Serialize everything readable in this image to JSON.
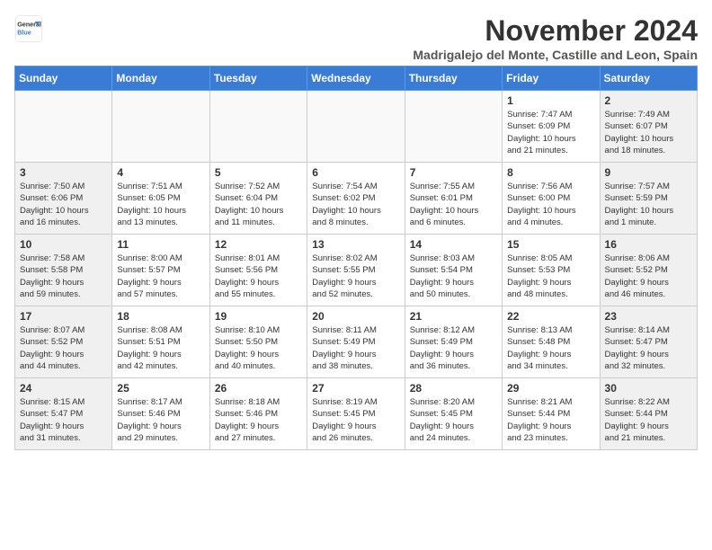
{
  "logo": {
    "line1": "General",
    "line2": "Blue"
  },
  "title": "November 2024",
  "subtitle": "Madrigalejo del Monte, Castille and Leon, Spain",
  "days_of_week": [
    "Sunday",
    "Monday",
    "Tuesday",
    "Wednesday",
    "Thursday",
    "Friday",
    "Saturday"
  ],
  "weeks": [
    [
      {
        "day": "",
        "info": ""
      },
      {
        "day": "",
        "info": ""
      },
      {
        "day": "",
        "info": ""
      },
      {
        "day": "",
        "info": ""
      },
      {
        "day": "",
        "info": ""
      },
      {
        "day": "1",
        "info": "Sunrise: 7:47 AM\nSunset: 6:09 PM\nDaylight: 10 hours\nand 21 minutes."
      },
      {
        "day": "2",
        "info": "Sunrise: 7:49 AM\nSunset: 6:07 PM\nDaylight: 10 hours\nand 18 minutes."
      }
    ],
    [
      {
        "day": "3",
        "info": "Sunrise: 7:50 AM\nSunset: 6:06 PM\nDaylight: 10 hours\nand 16 minutes."
      },
      {
        "day": "4",
        "info": "Sunrise: 7:51 AM\nSunset: 6:05 PM\nDaylight: 10 hours\nand 13 minutes."
      },
      {
        "day": "5",
        "info": "Sunrise: 7:52 AM\nSunset: 6:04 PM\nDaylight: 10 hours\nand 11 minutes."
      },
      {
        "day": "6",
        "info": "Sunrise: 7:54 AM\nSunset: 6:02 PM\nDaylight: 10 hours\nand 8 minutes."
      },
      {
        "day": "7",
        "info": "Sunrise: 7:55 AM\nSunset: 6:01 PM\nDaylight: 10 hours\nand 6 minutes."
      },
      {
        "day": "8",
        "info": "Sunrise: 7:56 AM\nSunset: 6:00 PM\nDaylight: 10 hours\nand 4 minutes."
      },
      {
        "day": "9",
        "info": "Sunrise: 7:57 AM\nSunset: 5:59 PM\nDaylight: 10 hours\nand 1 minute."
      }
    ],
    [
      {
        "day": "10",
        "info": "Sunrise: 7:58 AM\nSunset: 5:58 PM\nDaylight: 9 hours\nand 59 minutes."
      },
      {
        "day": "11",
        "info": "Sunrise: 8:00 AM\nSunset: 5:57 PM\nDaylight: 9 hours\nand 57 minutes."
      },
      {
        "day": "12",
        "info": "Sunrise: 8:01 AM\nSunset: 5:56 PM\nDaylight: 9 hours\nand 55 minutes."
      },
      {
        "day": "13",
        "info": "Sunrise: 8:02 AM\nSunset: 5:55 PM\nDaylight: 9 hours\nand 52 minutes."
      },
      {
        "day": "14",
        "info": "Sunrise: 8:03 AM\nSunset: 5:54 PM\nDaylight: 9 hours\nand 50 minutes."
      },
      {
        "day": "15",
        "info": "Sunrise: 8:05 AM\nSunset: 5:53 PM\nDaylight: 9 hours\nand 48 minutes."
      },
      {
        "day": "16",
        "info": "Sunrise: 8:06 AM\nSunset: 5:52 PM\nDaylight: 9 hours\nand 46 minutes."
      }
    ],
    [
      {
        "day": "17",
        "info": "Sunrise: 8:07 AM\nSunset: 5:52 PM\nDaylight: 9 hours\nand 44 minutes."
      },
      {
        "day": "18",
        "info": "Sunrise: 8:08 AM\nSunset: 5:51 PM\nDaylight: 9 hours\nand 42 minutes."
      },
      {
        "day": "19",
        "info": "Sunrise: 8:10 AM\nSunset: 5:50 PM\nDaylight: 9 hours\nand 40 minutes."
      },
      {
        "day": "20",
        "info": "Sunrise: 8:11 AM\nSunset: 5:49 PM\nDaylight: 9 hours\nand 38 minutes."
      },
      {
        "day": "21",
        "info": "Sunrise: 8:12 AM\nSunset: 5:49 PM\nDaylight: 9 hours\nand 36 minutes."
      },
      {
        "day": "22",
        "info": "Sunrise: 8:13 AM\nSunset: 5:48 PM\nDaylight: 9 hours\nand 34 minutes."
      },
      {
        "day": "23",
        "info": "Sunrise: 8:14 AM\nSunset: 5:47 PM\nDaylight: 9 hours\nand 32 minutes."
      }
    ],
    [
      {
        "day": "24",
        "info": "Sunrise: 8:15 AM\nSunset: 5:47 PM\nDaylight: 9 hours\nand 31 minutes."
      },
      {
        "day": "25",
        "info": "Sunrise: 8:17 AM\nSunset: 5:46 PM\nDaylight: 9 hours\nand 29 minutes."
      },
      {
        "day": "26",
        "info": "Sunrise: 8:18 AM\nSunset: 5:46 PM\nDaylight: 9 hours\nand 27 minutes."
      },
      {
        "day": "27",
        "info": "Sunrise: 8:19 AM\nSunset: 5:45 PM\nDaylight: 9 hours\nand 26 minutes."
      },
      {
        "day": "28",
        "info": "Sunrise: 8:20 AM\nSunset: 5:45 PM\nDaylight: 9 hours\nand 24 minutes."
      },
      {
        "day": "29",
        "info": "Sunrise: 8:21 AM\nSunset: 5:44 PM\nDaylight: 9 hours\nand 23 minutes."
      },
      {
        "day": "30",
        "info": "Sunrise: 8:22 AM\nSunset: 5:44 PM\nDaylight: 9 hours\nand 21 minutes."
      }
    ]
  ]
}
